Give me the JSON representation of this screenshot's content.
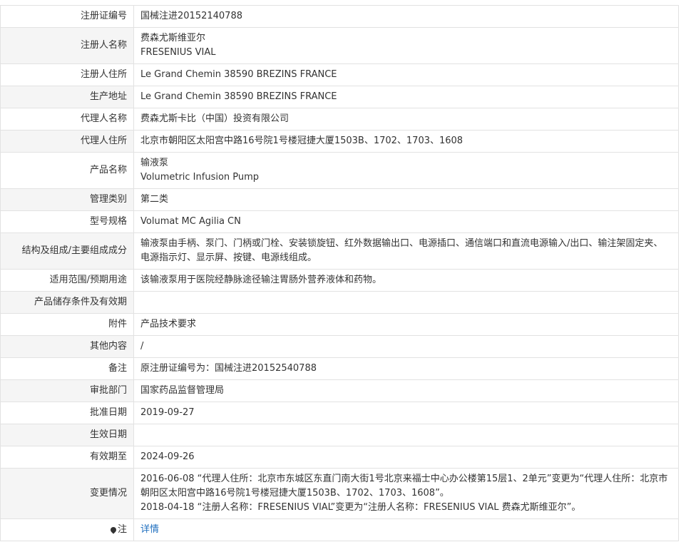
{
  "rows": [
    {
      "label": "注册证编号",
      "lines": [
        "国械注进20152140788"
      ]
    },
    {
      "label": "注册人名称",
      "lines": [
        "费森尤斯维亚尔",
        "FRESENIUS VIAL"
      ]
    },
    {
      "label": "注册人住所",
      "lines": [
        "Le Grand Chemin 38590 BREZINS FRANCE"
      ]
    },
    {
      "label": "生产地址",
      "lines": [
        "Le Grand Chemin 38590 BREZINS FRANCE"
      ]
    },
    {
      "label": "代理人名称",
      "lines": [
        "费森尤斯卡比（中国）投资有限公司"
      ]
    },
    {
      "label": "代理人住所",
      "lines": [
        "北京市朝阳区太阳宫中路16号院1号楼冠捷大厦1503B、1702、1703、1608"
      ]
    },
    {
      "label": "产品名称",
      "lines": [
        "输液泵",
        "Volumetric Infusion Pump"
      ]
    },
    {
      "label": "管理类别",
      "lines": [
        "第二类"
      ]
    },
    {
      "label": "型号规格",
      "lines": [
        "Volumat MC Agilia CN"
      ]
    },
    {
      "label": "结构及组成/主要组成成分",
      "lines": [
        "输液泵由手柄、泵门、门柄或门栓、安装锁旋钮、红外数据输出口、电源插口、通信端口和直流电源输入/出口、输注架固定夹、电源指示灯、显示屏、按键、电源线组成。"
      ]
    },
    {
      "label": "适用范围/预期用途",
      "lines": [
        "该输液泵用于医院经静脉途径输注胃肠外营养液体和药物。"
      ]
    },
    {
      "label": "产品储存条件及有效期",
      "lines": []
    },
    {
      "label": "附件",
      "lines": [
        "产品技术要求"
      ]
    },
    {
      "label": "其他内容",
      "lines": [
        "/"
      ]
    },
    {
      "label": "备注",
      "lines": [
        "原注册证编号为：国械注进20152540788"
      ]
    },
    {
      "label": "审批部门",
      "lines": [
        "国家药品监督管理局"
      ]
    },
    {
      "label": "批准日期",
      "lines": [
        "2019-09-27"
      ]
    },
    {
      "label": "生效日期",
      "lines": []
    },
    {
      "label": "有效期至",
      "lines": [
        "2024-09-26"
      ]
    },
    {
      "label": "变更情况",
      "lines": [
        "2016-06-08 “代理人住所：北京市东城区东直门南大街1号北京来福士中心办公楼第15层1、2单元”变更为“代理人住所：北京市朝阳区太阳宫中路16号院1号楼冠捷大厦1503B、1702、1703、1608”。",
        "2018-04-18 “注册人名称：FRESENIUS VIAL”变更为“注册人名称：FRESENIUS VIAL 费森尤斯维亚尔”。"
      ]
    }
  ],
  "note": {
    "label": "注",
    "link_text": "详情",
    "icon": "map-pin-icon"
  },
  "colors": {
    "border": "#e2e2e2",
    "label_alt_bg": "#f5f5f5",
    "link": "#1f6fbf"
  }
}
